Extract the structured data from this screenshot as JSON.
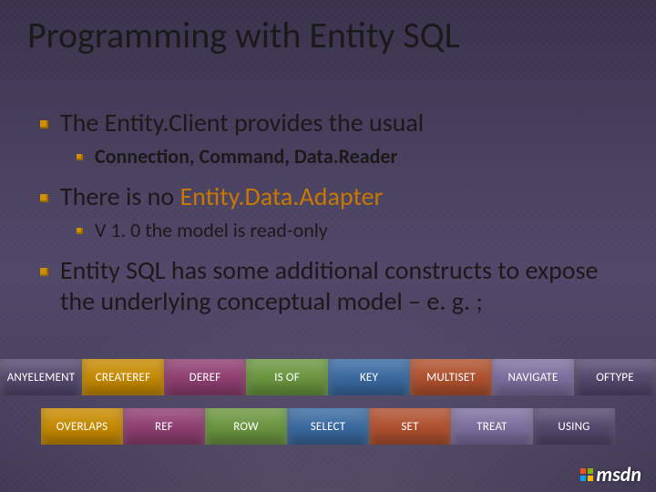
{
  "title": "Programming with Entity SQL",
  "bullets": {
    "b1": "The Entity.Client provides the usual",
    "b1a": "Connection, Command, Data.Reader",
    "b2_pre": "There is no ",
    "b2_emph": "Entity.Data.Adapter",
    "b2a": "V 1. 0 the model is read-only",
    "b3": "Entity SQL has some additional constructs to expose the underlying conceptual model – e. g. ;"
  },
  "row1": [
    "ANYELEMENT",
    "CREATEREF",
    "DEREF",
    "IS OF",
    "KEY",
    "MULTISET",
    "NAVIGATE",
    "OFTYPE"
  ],
  "row2": [
    "OVERLAPS",
    "REF",
    "ROW",
    "SELECT",
    "SET",
    "TREAT",
    "USING"
  ],
  "logo": "msdn"
}
